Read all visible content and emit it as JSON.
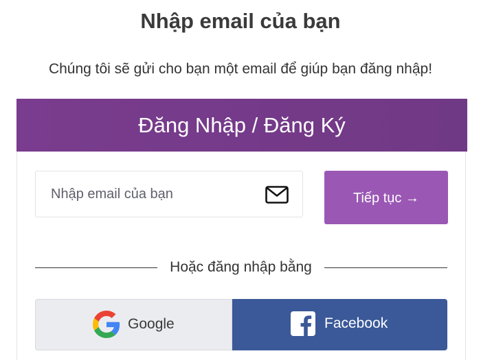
{
  "header": {
    "title": "Nhập email của bạn",
    "subtitle": "Chúng tôi sẽ gửi cho bạn một email để giúp bạn đăng nhập!"
  },
  "card": {
    "title": "Đăng Nhập / Đăng Ký",
    "email": {
      "placeholder": "Nhập email của bạn",
      "value": "",
      "icon": "envelope-icon"
    },
    "continue_label": "Tiếp tục →",
    "divider_text": "Hoặc đăng nhập bằng",
    "social": {
      "google_label": "Google",
      "google_icon": "google-icon",
      "facebook_label": "Facebook",
      "facebook_icon": "facebook-icon"
    }
  },
  "colors": {
    "header_bg": "#7a3c8e",
    "accent": "#9a58b4",
    "facebook": "#3b5998",
    "google_bg": "#ebecf0"
  }
}
